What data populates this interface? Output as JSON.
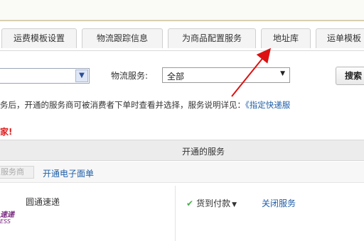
{
  "tabs": [
    {
      "label": "运费模板设置"
    },
    {
      "label": "物流跟踪信息"
    },
    {
      "label": "为商品配置服务"
    },
    {
      "label": "地址库"
    },
    {
      "label": "运单模板"
    }
  ],
  "filters": {
    "shipping_label": "物流服务:",
    "shipping_value": "全部",
    "search_button": "搜索"
  },
  "notice": {
    "text": "务后，开通的服务商可被消费者下单时查看并选择，服务说明详见：",
    "link": "《指定快递服"
  },
  "warning": "家!",
  "table": {
    "header": "开通的服务",
    "toolbar_disabled": "服务商",
    "toolbar_link": "开通电子面单",
    "row": {
      "logo_line1": "速递",
      "logo_line2": "ESS",
      "carrier": "圆通速递",
      "service": "货到付款",
      "action": "关闭服务"
    }
  }
}
